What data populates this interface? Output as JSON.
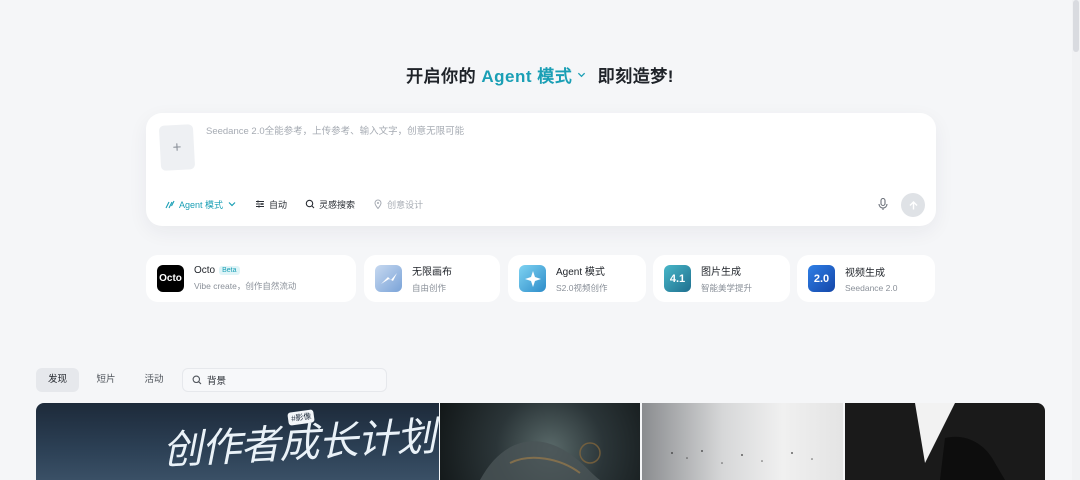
{
  "headline": {
    "prefix": "开启你的",
    "mode": "Agent 模式",
    "suffix": "即刻造梦!"
  },
  "prompt": {
    "placeholder": "Seedance 2.0全能参考，上传参考、输入文字，创意无限可能",
    "upload_symbol": "+",
    "tools": {
      "agent": "Agent 模式",
      "auto": "自动",
      "inspiration": "灵感搜索",
      "idea": "创意设计"
    }
  },
  "features": [
    {
      "title": "Octo",
      "badge": "Beta",
      "subtitle": "Vibe create，创作自然流动",
      "icon_text": "Octo"
    },
    {
      "title": "无限画布",
      "subtitle": "自由创作"
    },
    {
      "title": "Agent 模式",
      "subtitle": "S2.0视频创作"
    },
    {
      "title": "图片生成",
      "subtitle": "智能美学提升",
      "icon_text": "4.1"
    },
    {
      "title": "视频生成",
      "subtitle": "Seedance 2.0",
      "icon_text": "2.0"
    }
  ],
  "tabs": [
    "发现",
    "短片",
    "活动"
  ],
  "search": {
    "value": "背景"
  },
  "gallery": {
    "tile1_title": "创作者成长计划",
    "tile1_tag": "#影像"
  },
  "colors": {
    "accent": "#1a9fb5",
    "background": "#f5f6f8"
  },
  "icons": [
    "chevron-down-icon",
    "plus-icon",
    "sparkle-icon",
    "sliders-icon",
    "search-icon",
    "location-pin-icon",
    "microphone-icon",
    "arrow-up-icon"
  ]
}
